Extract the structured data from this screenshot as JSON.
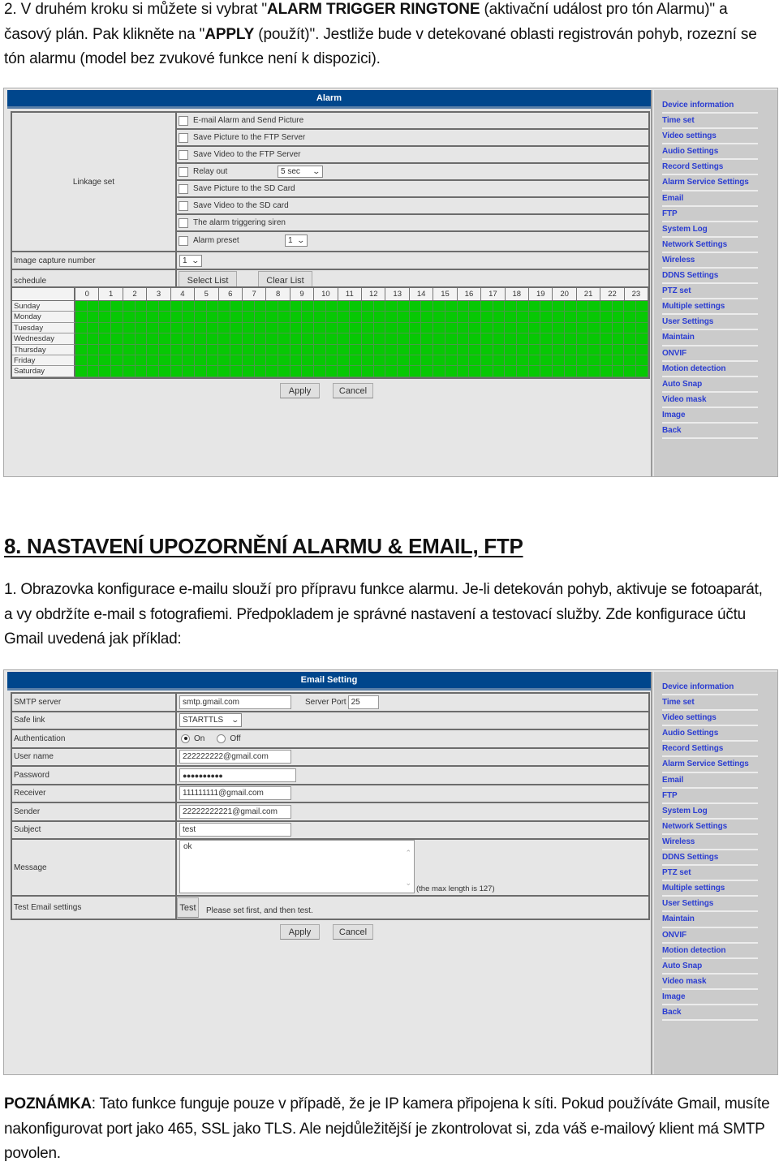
{
  "intro": {
    "prefix": "2. V druhém kroku si můžete si vybrat \"",
    "bold1": "ALARM TRIGGER RINGTONE",
    "mid1": " (aktivační událost pro tón Alarmu)\" a časový plán. Pak klikněte na \"",
    "bold2": "APPLY",
    "mid2": " (použít)\". Jestliže bude v detekované oblasti registrován pohyb, rozezní se tón alarmu (model bez zvukové funkce není k dispozici)."
  },
  "section_heading": "8. NASTAVENÍ UPOZORNĚNÍ ALARMU & EMAIL, FTP",
  "section_paragraph": "1. Obrazovka konfigurace e-mailu slouží pro přípravu funkce alarmu. Je-li detekován pohyb, aktivuje se fotoaparát, a vy obdržíte e-mail s fotografiemi. Předpokladem je správné nastavení a testovací služby. Zde konfigurace účtu Gmail uvedená jak příklad:",
  "note": {
    "label": "POZNÁMKA",
    "text": ": Tato funkce funguje pouze v případě, že je IP kamera připojena k síti. Pokud používáte Gmail, musíte nakonfigurovat port jako 465, SSL jako TLS. Ale nejdůležitější je zkontrolovat si, zda váš e-mailový klient má SMTP povolen."
  },
  "colors": {
    "header_blue": "#00468c",
    "link_blue": "#2b3dd1",
    "schedule_green": "#07c804",
    "panel_gray": "#e6e6e6",
    "sidebar_gray": "#cbcbcb"
  },
  "sidebar": {
    "items": [
      {
        "label": "Device information"
      },
      {
        "label": "Time set"
      },
      {
        "label": "Video settings"
      },
      {
        "label": "Audio Settings"
      },
      {
        "label": "Record Settings"
      },
      {
        "label": "Alarm Service Settings"
      },
      {
        "label": "Email"
      },
      {
        "label": "FTP"
      },
      {
        "label": "System Log"
      },
      {
        "label": "Network Settings"
      },
      {
        "label": "Wireless"
      },
      {
        "label": "DDNS Settings"
      },
      {
        "label": "PTZ set"
      },
      {
        "label": "Multiple settings"
      },
      {
        "label": "User Settings"
      },
      {
        "label": "Maintain"
      },
      {
        "label": "ONVIF"
      },
      {
        "label": "Motion detection"
      },
      {
        "label": "Auto Snap"
      },
      {
        "label": "Video mask"
      },
      {
        "label": "Image"
      },
      {
        "label": "Back"
      }
    ]
  },
  "alarm": {
    "title": "Alarm",
    "linkage_label": "Linkage set",
    "options": [
      {
        "label": "E-mail Alarm and Send Picture",
        "checked": false
      },
      {
        "label": "Save Picture to the FTP Server",
        "checked": false
      },
      {
        "label": "Save Video to the FTP Server",
        "checked": false
      },
      {
        "label": "Relay out",
        "checked": false,
        "select": "5 sec"
      },
      {
        "label": "Save Picture to the SD Card",
        "checked": false
      },
      {
        "label": "Save Video to the SD card",
        "checked": false
      },
      {
        "label": "The alarm triggering siren",
        "checked": false
      },
      {
        "label": "Alarm preset",
        "checked": false,
        "select": "1"
      }
    ],
    "image_capture_label": "Image capture number",
    "image_capture_value": "1",
    "schedule_label": "schedule",
    "select_list": "Select List",
    "clear_list": "Clear List",
    "hours": [
      "0",
      "1",
      "2",
      "3",
      "4",
      "5",
      "6",
      "7",
      "8",
      "9",
      "10",
      "11",
      "12",
      "13",
      "14",
      "15",
      "16",
      "17",
      "18",
      "19",
      "20",
      "21",
      "22",
      "23"
    ],
    "days": [
      "Sunday",
      "Monday",
      "Tuesday",
      "Wednesday",
      "Thursday",
      "Friday",
      "Saturday"
    ],
    "slots_per_hour": 2,
    "schedule_all_selected": true,
    "apply": "Apply",
    "cancel": "Cancel"
  },
  "email": {
    "title": "Email Setting",
    "smtp_label": "SMTP server",
    "smtp_value": "smtp.gmail.com",
    "port_label": "Server Port",
    "port_value": "25",
    "safe_link_label": "Safe link",
    "safe_link_value": "STARTTLS",
    "auth_label": "Authentication",
    "auth_on": "On",
    "auth_off": "Off",
    "auth_selected": "On",
    "user_label": "User name",
    "user_value": "222222222@gmail.com",
    "password_label": "Password",
    "password_value": "●●●●●●●●●●",
    "receiver_label": "Receiver",
    "receiver_value": "111111111@gmail.com",
    "sender_label": "Sender",
    "sender_value": "22222222221@gmail.com",
    "subject_label": "Subject",
    "subject_value": "test",
    "message_label": "Message",
    "message_value": "ok",
    "max_length_note": "(the max length is 127)",
    "test_label": "Test Email settings",
    "test_button": "Test",
    "test_hint": "Please set first, and then test.",
    "apply": "Apply",
    "cancel": "Cancel"
  }
}
